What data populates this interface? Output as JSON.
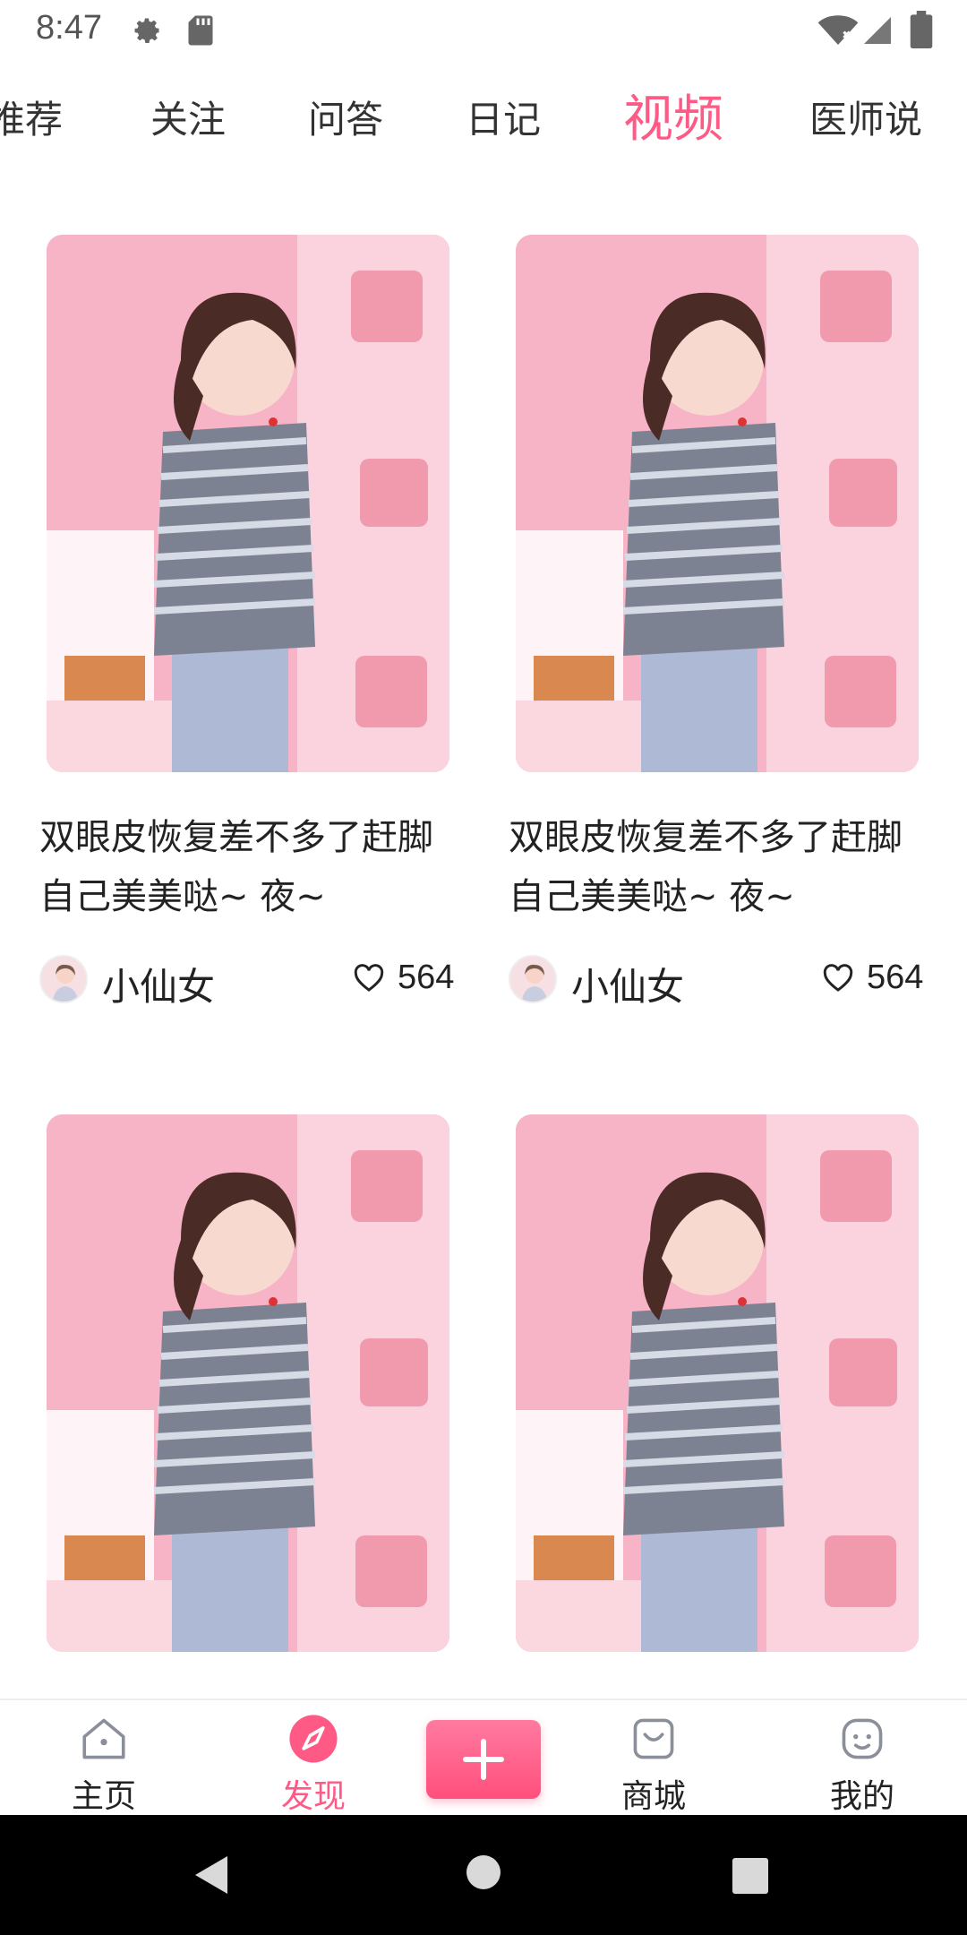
{
  "status_bar": {
    "time": "8:47"
  },
  "tabs": [
    {
      "label": "推荐"
    },
    {
      "label": "关注"
    },
    {
      "label": "问答"
    },
    {
      "label": "日记"
    },
    {
      "label": "视频"
    },
    {
      "label": "医师说"
    }
  ],
  "active_tab": "视频",
  "cards": [
    {
      "title": "双眼皮恢复差不多了赶脚自己美美哒~ 夜~",
      "author": "小仙女",
      "likes": "564"
    },
    {
      "title": "双眼皮恢复差不多了赶脚自己美美哒~ 夜~",
      "author": "小仙女",
      "likes": "564"
    },
    {
      "title": "",
      "author": "",
      "likes": ""
    },
    {
      "title": "",
      "author": "",
      "likes": ""
    }
  ],
  "bottom_nav": {
    "items": [
      {
        "label": "主页",
        "icon": "home-icon"
      },
      {
        "label": "发现",
        "icon": "compass-icon"
      },
      {
        "label": "商城",
        "icon": "shop-icon"
      },
      {
        "label": "我的",
        "icon": "smile-icon"
      }
    ],
    "active": "发现",
    "plus_icon": "plus-icon"
  },
  "colors": {
    "accent": "#ff5a85",
    "text": "#222222",
    "system_bar": "#000000"
  }
}
